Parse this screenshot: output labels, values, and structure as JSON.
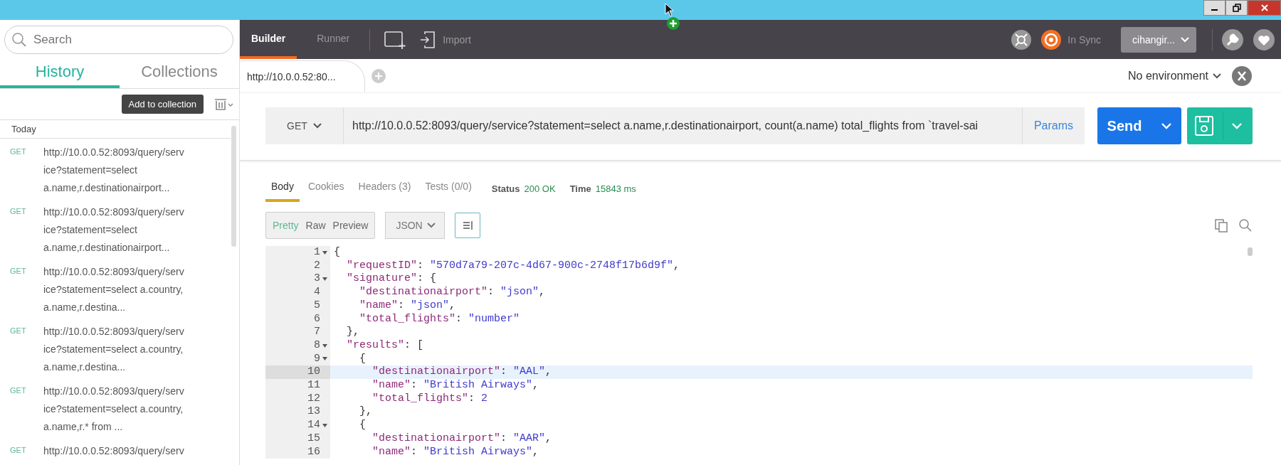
{
  "sidebar": {
    "search": {
      "placeholder": "Search"
    },
    "tabs": [
      {
        "label": "History",
        "selected": true
      },
      {
        "label": "Collections",
        "selected": false
      }
    ],
    "add_button": "Add to collection",
    "group": "Today",
    "history": [
      {
        "method": "GET",
        "lines": [
          "http://10.0.0.52:8093/query/serv",
          "ice?statement=select",
          "a.name,r.destinationairport..."
        ]
      },
      {
        "method": "GET",
        "lines": [
          "http://10.0.0.52:8093/query/serv",
          "ice?statement=select",
          "a.name,r.destinationairport..."
        ]
      },
      {
        "method": "GET",
        "lines": [
          "http://10.0.0.52:8093/query/serv",
          "ice?statement=select a.country,",
          "a.name,r.destina..."
        ]
      },
      {
        "method": "GET",
        "lines": [
          "http://10.0.0.52:8093/query/serv",
          "ice?statement=select a.country,",
          "a.name,r.destina..."
        ]
      },
      {
        "method": "GET",
        "lines": [
          "http://10.0.0.52:8093/query/serv",
          "ice?statement=select a.country,",
          "a.name,r.* from ..."
        ]
      },
      {
        "method": "GET",
        "lines": [
          "http://10.0.0.52:8093/query/serv"
        ]
      }
    ]
  },
  "toolbar": {
    "modes": [
      {
        "label": "Builder",
        "selected": true
      },
      {
        "label": "Runner",
        "selected": false
      }
    ],
    "import": "Import",
    "sync": "In Sync",
    "user": "cihangir..."
  },
  "request_tab": "http://10.0.0.52:80...",
  "environment": "No environment",
  "request": {
    "method": "GET",
    "url": "http://10.0.0.52:8093/query/service?statement=select a.name,r.destinationairport, count(a.name) total_flights from `travel-sai",
    "params": "Params",
    "send": "Send"
  },
  "response": {
    "tabs": [
      {
        "label": "Body",
        "selected": true
      },
      {
        "label": "Cookies",
        "selected": false
      },
      {
        "label": "Headers (3)",
        "selected": false
      },
      {
        "label": "Tests (0/0)",
        "selected": false
      }
    ],
    "status_label": "Status",
    "status": "200 OK",
    "time_label": "Time",
    "time": "15843 ms",
    "views": [
      {
        "label": "Pretty",
        "selected": true
      },
      {
        "label": "Raw",
        "selected": false
      },
      {
        "label": "Preview",
        "selected": false
      }
    ],
    "format": "JSON",
    "code": [
      {
        "number": "1",
        "fold": true,
        "selected": false,
        "tokens": [
          {
            "kind": "punct",
            "text": "{"
          }
        ]
      },
      {
        "number": "2",
        "fold": false,
        "selected": false,
        "tokens": [
          {
            "kind": "key",
            "text": "  \"requestID\""
          },
          {
            "kind": "punct",
            "text": ": "
          },
          {
            "kind": "string",
            "text": "\"570d7a79-207c-4d67-900c-2748f17b6d9f\""
          },
          {
            "kind": "punct",
            "text": ","
          }
        ]
      },
      {
        "number": "3",
        "fold": true,
        "selected": false,
        "tokens": [
          {
            "kind": "key",
            "text": "  \"signature\""
          },
          {
            "kind": "punct",
            "text": ": {"
          }
        ]
      },
      {
        "number": "4",
        "fold": false,
        "selected": false,
        "tokens": [
          {
            "kind": "key",
            "text": "    \"destinationairport\""
          },
          {
            "kind": "punct",
            "text": ": "
          },
          {
            "kind": "string",
            "text": "\"json\""
          },
          {
            "kind": "punct",
            "text": ","
          }
        ]
      },
      {
        "number": "5",
        "fold": false,
        "selected": false,
        "tokens": [
          {
            "kind": "key",
            "text": "    \"name\""
          },
          {
            "kind": "punct",
            "text": ": "
          },
          {
            "kind": "string",
            "text": "\"json\""
          },
          {
            "kind": "punct",
            "text": ","
          }
        ]
      },
      {
        "number": "6",
        "fold": false,
        "selected": false,
        "tokens": [
          {
            "kind": "key",
            "text": "    \"total_flights\""
          },
          {
            "kind": "punct",
            "text": ": "
          },
          {
            "kind": "string",
            "text": "\"number\""
          }
        ]
      },
      {
        "number": "7",
        "fold": false,
        "selected": false,
        "tokens": [
          {
            "kind": "punct",
            "text": "  },"
          }
        ]
      },
      {
        "number": "8",
        "fold": true,
        "selected": false,
        "tokens": [
          {
            "kind": "key",
            "text": "  \"results\""
          },
          {
            "kind": "punct",
            "text": ": ["
          }
        ]
      },
      {
        "number": "9",
        "fold": true,
        "selected": false,
        "tokens": [
          {
            "kind": "punct",
            "text": "    {"
          }
        ]
      },
      {
        "number": "10",
        "fold": false,
        "selected": true,
        "tokens": [
          {
            "kind": "key",
            "text": "      \"destinationairport\""
          },
          {
            "kind": "punct",
            "text": ": "
          },
          {
            "kind": "string",
            "text": "\"AAL\""
          },
          {
            "kind": "punct",
            "text": ","
          }
        ]
      },
      {
        "number": "11",
        "fold": false,
        "selected": false,
        "tokens": [
          {
            "kind": "key",
            "text": "      \"name\""
          },
          {
            "kind": "punct",
            "text": ": "
          },
          {
            "kind": "string",
            "text": "\"British Airways\""
          },
          {
            "kind": "punct",
            "text": ","
          }
        ]
      },
      {
        "number": "12",
        "fold": false,
        "selected": false,
        "tokens": [
          {
            "kind": "key",
            "text": "      \"total_flights\""
          },
          {
            "kind": "punct",
            "text": ": "
          },
          {
            "kind": "number",
            "text": "2"
          }
        ]
      },
      {
        "number": "13",
        "fold": false,
        "selected": false,
        "tokens": [
          {
            "kind": "punct",
            "text": "    },"
          }
        ]
      },
      {
        "number": "14",
        "fold": true,
        "selected": false,
        "tokens": [
          {
            "kind": "punct",
            "text": "    {"
          }
        ]
      },
      {
        "number": "15",
        "fold": false,
        "selected": false,
        "tokens": [
          {
            "kind": "key",
            "text": "      \"destinationairport\""
          },
          {
            "kind": "punct",
            "text": ": "
          },
          {
            "kind": "string",
            "text": "\"AAR\""
          },
          {
            "kind": "punct",
            "text": ","
          }
        ]
      },
      {
        "number": "16",
        "fold": false,
        "selected": false,
        "tokens": [
          {
            "kind": "key",
            "text": "      \"name\""
          },
          {
            "kind": "punct",
            "text": ": "
          },
          {
            "kind": "string",
            "text": "\"British Airways\""
          },
          {
            "kind": "punct",
            "text": ","
          }
        ]
      }
    ]
  }
}
